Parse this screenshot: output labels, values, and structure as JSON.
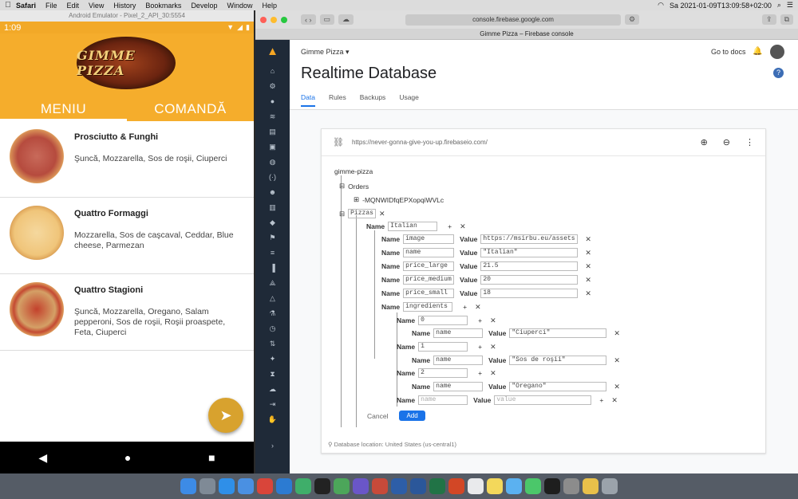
{
  "menubar": {
    "apple": "",
    "items": [
      "Safari",
      "File",
      "Edit",
      "View",
      "History",
      "Bookmarks",
      "Develop",
      "Window",
      "Help"
    ],
    "clock": "Sa 2021-01-09T13:09:58+02:00"
  },
  "emulator": {
    "window_title": "Android Emulator - Pixel_2_API_30:5554",
    "time": "1:09",
    "logo_text": "GIMME PIZZA",
    "tabs": [
      "MENIU",
      "COMANDĂ"
    ],
    "pizzas": [
      {
        "name": "Prosciutto & Funghi",
        "desc": "Şuncă, Mozzarella, Sos de roşii, Ciuperci"
      },
      {
        "name": "Quattro Formaggi",
        "desc": "Mozzarella, Sos de caşcaval, Ceddar, Blue cheese, Parmezan"
      },
      {
        "name": "Quattro Stagioni",
        "desc": "Şuncă, Mozzarella, Oregano, Salam pepperoni, Sos de roşii, Roşii proaspete, Feta, Ciuperci"
      }
    ],
    "nav": [
      "◀",
      "●",
      "■"
    ]
  },
  "safari": {
    "url": "console.firebase.google.com",
    "tab_title": "Gimme Pizza – Firebase console"
  },
  "firebase": {
    "project": "Gimme Pizza ▾",
    "go_to_docs": "Go to docs",
    "title": "Realtime Database",
    "tabs": [
      "Data",
      "Rules",
      "Backups",
      "Usage"
    ],
    "db_url": "https://never-gonna-give-you-up.firebaseio.com/",
    "root": "gimme-pizza",
    "orders_key": "Orders",
    "order_id": "-MQNWIDfqEPXopqiWVLc",
    "pizzas_key": "Pizzas",
    "name_label": "Name",
    "value_label": "Value",
    "new_name": "Italian",
    "fields": [
      {
        "name": "image",
        "value": "https://msirbu.eu/assets"
      },
      {
        "name": "name",
        "value": "\"Italian\""
      },
      {
        "name": "price_large",
        "value": "21.5"
      },
      {
        "name": "price_medium",
        "value": "20"
      },
      {
        "name": "price_small",
        "value": "18"
      }
    ],
    "ingredients_key": "ingredients",
    "ingredients": [
      {
        "index": "0",
        "name": "name",
        "value": "\"Ciuperci\""
      },
      {
        "index": "1",
        "name": "name",
        "value": "\"Sos de roşii\""
      },
      {
        "index": "2",
        "name": "name",
        "value": "\"Oregano\""
      }
    ],
    "placeholder_name": "name",
    "placeholder_value": "value",
    "cancel": "Cancel",
    "add": "Add",
    "location": "Database location: United States (us-central1)"
  }
}
